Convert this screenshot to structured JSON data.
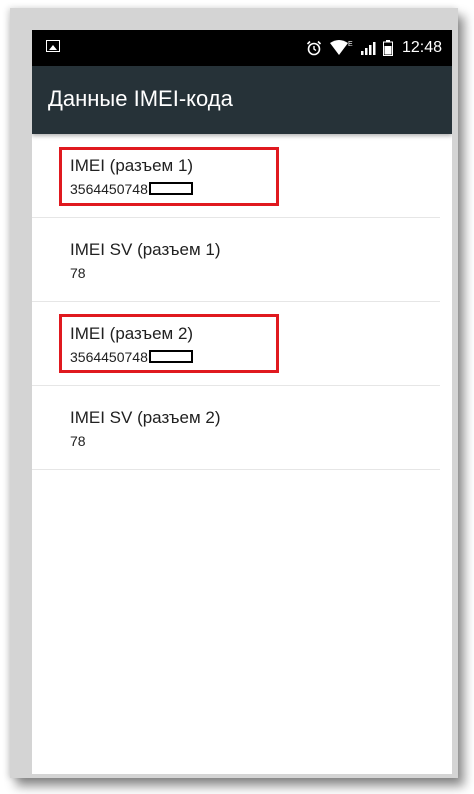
{
  "status_bar": {
    "time": "12:48",
    "icons": [
      "image-icon",
      "alarm-icon",
      "wifi-icon",
      "signal-icon",
      "battery-icon"
    ]
  },
  "app_bar": {
    "title": "Данные IMEI-кода"
  },
  "items": [
    {
      "title": "IMEI (разъем 1)",
      "value": "3564450748",
      "redacted": true,
      "highlighted": true
    },
    {
      "title": "IMEI SV (разъем 1)",
      "value": "78",
      "redacted": false,
      "highlighted": false
    },
    {
      "title": "IMEI (разъем 2)",
      "value": "3564450748",
      "redacted": true,
      "highlighted": true
    },
    {
      "title": "IMEI SV (разъем 2)",
      "value": "78",
      "redacted": false,
      "highlighted": false
    }
  ],
  "colors": {
    "app_bar": "#263238",
    "status_bar": "#000000",
    "highlight": "#e0191f"
  }
}
